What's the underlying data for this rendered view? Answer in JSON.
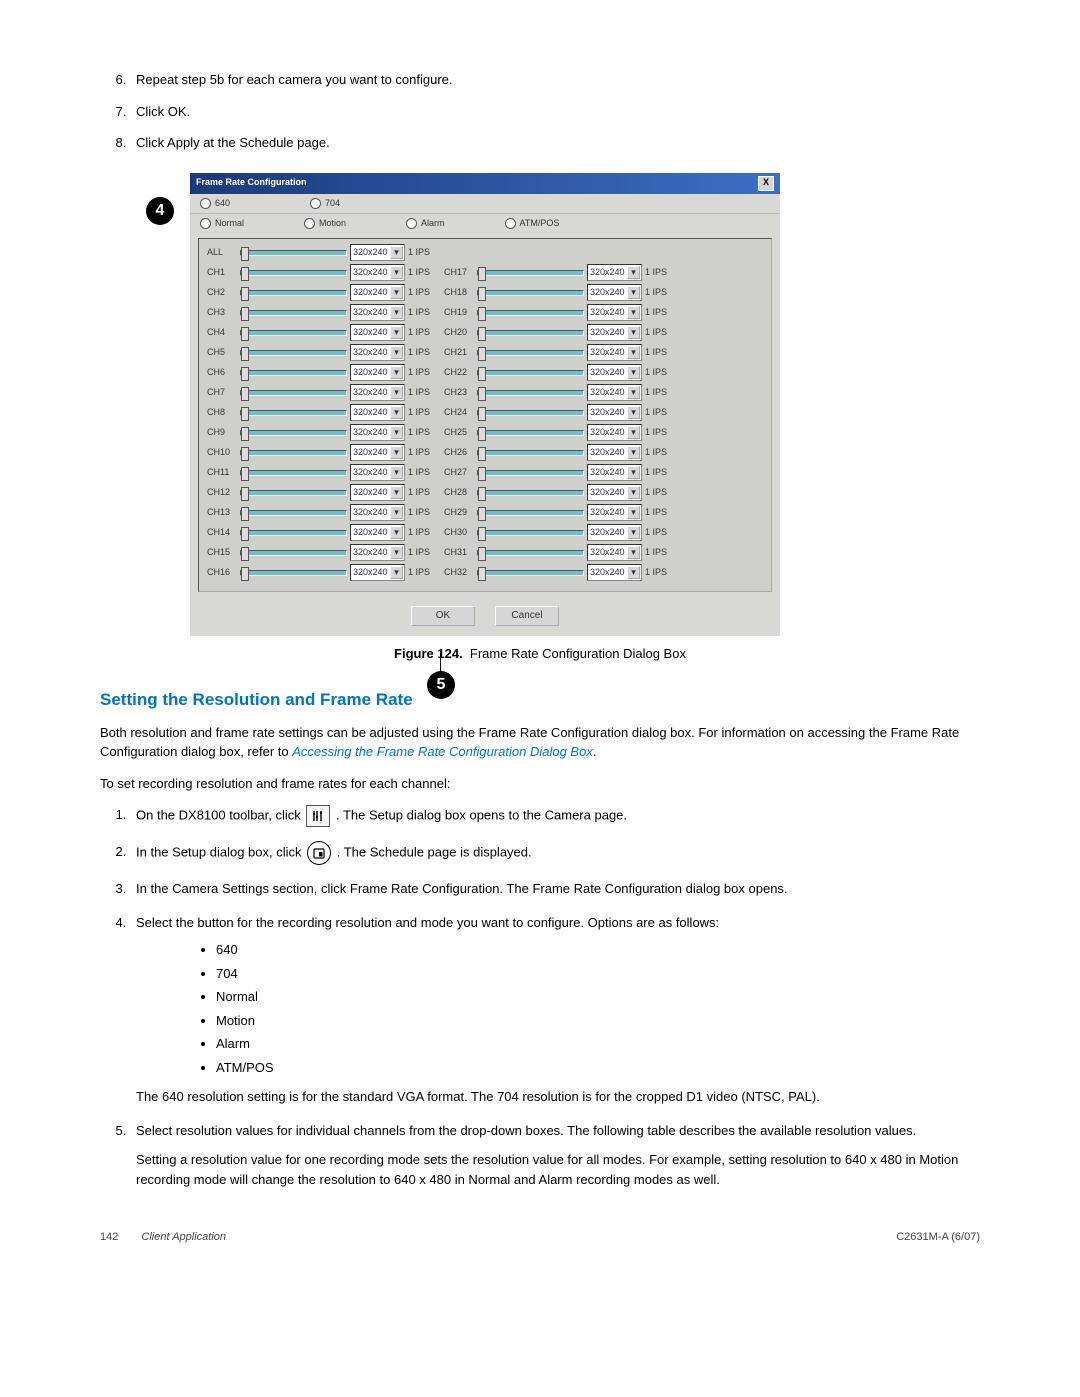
{
  "top_steps": [
    "Repeat step 5b for each camera you want to configure.",
    "Click OK.",
    "Click Apply at the Schedule page."
  ],
  "callouts": {
    "top": "4",
    "bottom": "5"
  },
  "dialog": {
    "title": "Frame Rate Configuration",
    "close": "X",
    "radios_res": [
      "640",
      "704"
    ],
    "radios_mode": [
      "Normal",
      "Motion",
      "Alarm",
      "ATM/POS"
    ],
    "res_option": "320x240",
    "ips": "1 IPS",
    "ch_all": "ALL",
    "left_channels": [
      "CH1",
      "CH2",
      "CH3",
      "CH4",
      "CH5",
      "CH6",
      "CH7",
      "CH8",
      "CH9",
      "CH10",
      "CH11",
      "CH12",
      "CH13",
      "CH14",
      "CH15",
      "CH16"
    ],
    "right_channels": [
      "CH17",
      "CH18",
      "CH19",
      "CH20",
      "CH21",
      "CH22",
      "CH23",
      "CH24",
      "CH25",
      "CH26",
      "CH27",
      "CH28",
      "CH29",
      "CH30",
      "CH31",
      "CH32"
    ],
    "ok": "OK",
    "cancel": "Cancel"
  },
  "caption_label": "Figure 124.",
  "caption_text": "Frame Rate Configuration Dialog Box",
  "section_heading": "Setting the Resolution and Frame Rate",
  "intro_p1": "Both resolution and frame rate settings can be adjusted using the Frame Rate Configuration dialog box. For information on accessing the Frame Rate Configuration dialog box, refer to ",
  "intro_link": "Accessing the Frame Rate Configuration Dialog Box",
  "intro_p2": "To set recording resolution and frame rates for each channel:",
  "steps": {
    "s1a": "On the DX8100 toolbar, click ",
    "s1b": ". The Setup dialog box opens to the Camera page.",
    "s2a": "In the Setup dialog box, click ",
    "s2b": ". The Schedule page is displayed.",
    "s3": "In the Camera Settings section, click Frame Rate Configuration. The Frame Rate Configuration dialog box opens.",
    "s4": "Select the button for the recording resolution and mode you want to configure. Options are as follows:",
    "s4_list": [
      "640",
      "704",
      "Normal",
      "Motion",
      "Alarm",
      "ATM/POS"
    ],
    "s4_after": "The 640 resolution setting is for the standard VGA format. The 704 resolution is for the cropped D1 video (NTSC, PAL).",
    "s5a": "Select resolution values for individual channels from the drop-down boxes. The following table describes the available resolution values.",
    "s5b": "Setting a resolution value for one recording mode sets the resolution value for all modes. For example, setting resolution to 640 x 480 in Motion recording mode will change the resolution to 640 x 480 in Normal and Alarm recording modes as well."
  },
  "footer": {
    "page": "142",
    "app": "Client Application",
    "code": "C2631M-A (6/07)"
  }
}
